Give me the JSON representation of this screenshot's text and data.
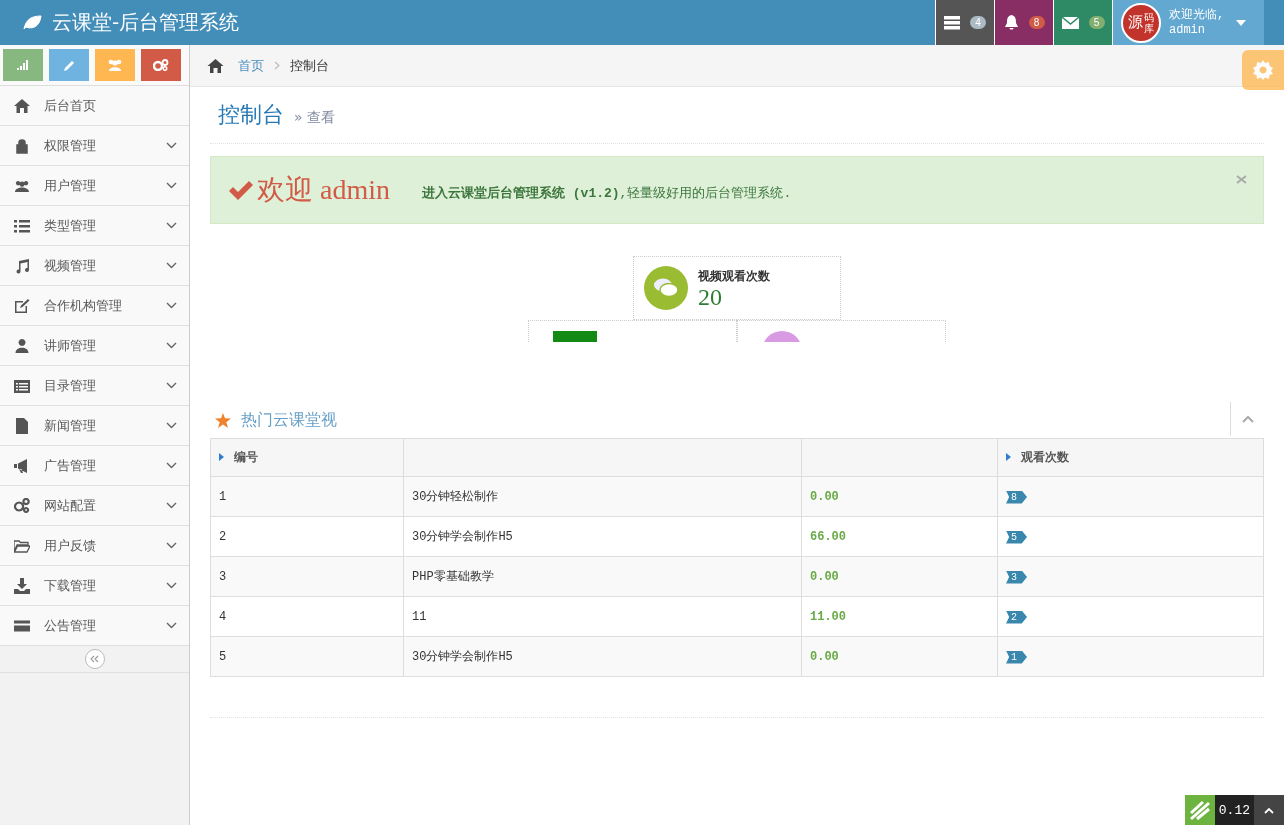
{
  "header": {
    "title": "云课堂-后台管理系统",
    "notifications": [
      {
        "kind": "tasks",
        "count": "4"
      },
      {
        "kind": "bell",
        "count": "8"
      },
      {
        "kind": "mail",
        "count": "5"
      }
    ],
    "user": {
      "avatar_text": "源",
      "avatar_sub": "码库",
      "greeting": "欢迎光临,",
      "name": "admin"
    }
  },
  "shortcuts": [
    {
      "kind": "chart"
    },
    {
      "kind": "pencil"
    },
    {
      "kind": "users"
    },
    {
      "kind": "cogs"
    }
  ],
  "sidebar": {
    "items": [
      {
        "label": "后台首页",
        "kind": "home",
        "has_submenu": false
      },
      {
        "label": "权限管理",
        "kind": "lock",
        "has_submenu": true
      },
      {
        "label": "用户管理",
        "kind": "users",
        "has_submenu": true
      },
      {
        "label": "类型管理",
        "kind": "list",
        "has_submenu": true
      },
      {
        "label": "视频管理",
        "kind": "music",
        "has_submenu": true
      },
      {
        "label": "合作机构管理",
        "kind": "edit",
        "has_submenu": true
      },
      {
        "label": "讲师管理",
        "kind": "user",
        "has_submenu": true
      },
      {
        "label": "目录管理",
        "kind": "listalt",
        "has_submenu": true
      },
      {
        "label": "新闻管理",
        "kind": "file",
        "has_submenu": true
      },
      {
        "label": "广告管理",
        "kind": "bullhorn",
        "has_submenu": true
      },
      {
        "label": "网站配置",
        "kind": "cogs",
        "has_submenu": true
      },
      {
        "label": "用户反馈",
        "kind": "folder",
        "has_submenu": true
      },
      {
        "label": "下载管理",
        "kind": "download",
        "has_submenu": true
      },
      {
        "label": "公告管理",
        "kind": "card",
        "has_submenu": true
      }
    ]
  },
  "breadcrumb": {
    "links": [
      "首页"
    ],
    "current": "控制台"
  },
  "page_header": {
    "title": "控制台",
    "subtitle": "» 查看"
  },
  "alert": {
    "heading": "欢迎 admin",
    "text": "**进入云课堂后台管理系统 (v1.2)**,轻量级好用的后台管理系统."
  },
  "stats": [
    {
      "kind": "comments",
      "label": "视频观看次数",
      "value": "20"
    }
  ],
  "stats_row2": [
    {
      "kind": "square"
    },
    {
      "kind": "circle"
    }
  ],
  "widget": {
    "title": "热门云课堂视",
    "table": {
      "columns": [
        "编号",
        "",
        "",
        "观看次数"
      ],
      "rows": [
        {
          "id": "1",
          "title": "30分钟轻松制作",
          "price": "0.00",
          "views": "8"
        },
        {
          "id": "2",
          "title": "30分钟学会制作H5",
          "price": "66.00",
          "views": "5"
        },
        {
          "id": "3",
          "title": "PHP零基础教学",
          "price": "0.00",
          "views": "3"
        },
        {
          "id": "4",
          "title": "11",
          "price": "11.00",
          "views": "2"
        },
        {
          "id": "5",
          "title": "30分钟学会制作H5",
          "price": "0.00",
          "views": "1"
        }
      ]
    }
  },
  "corner_widget": {
    "text": "0.12"
  }
}
